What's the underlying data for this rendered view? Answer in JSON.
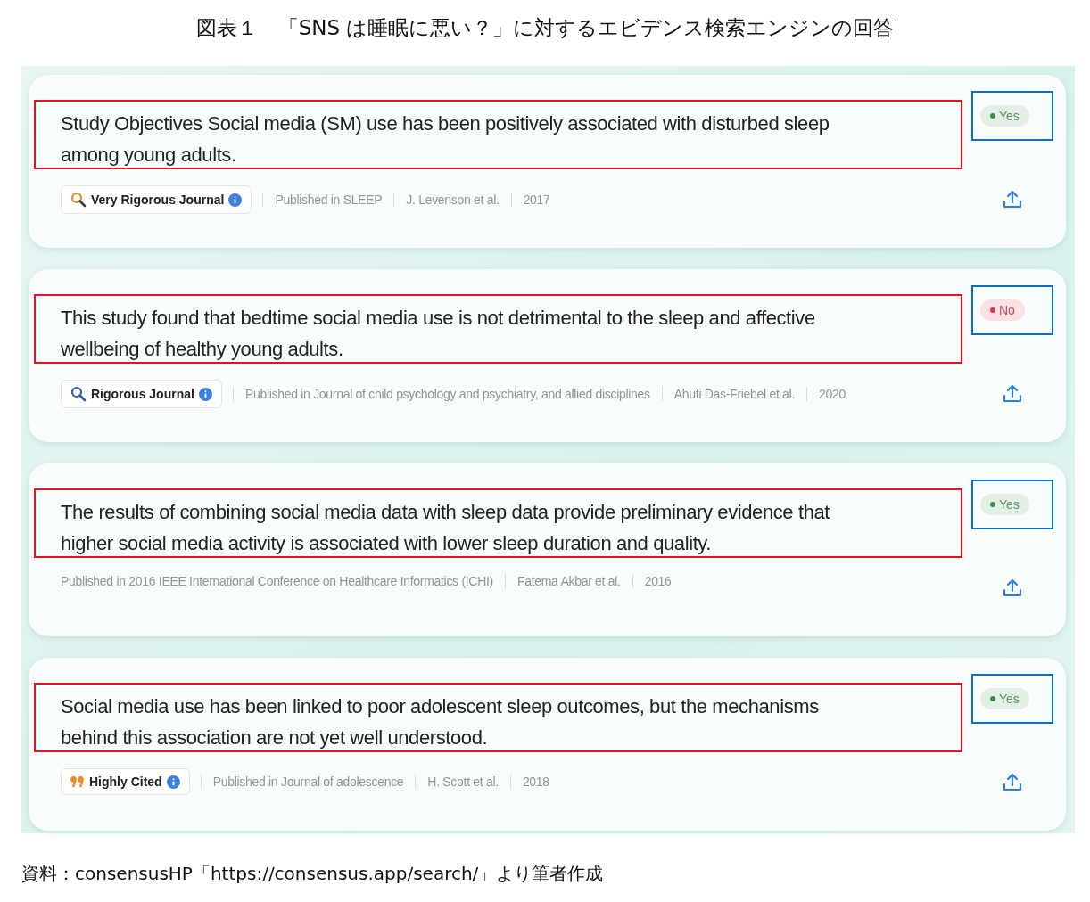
{
  "figure_title": "図表１　「SNS は睡眠に悪い？」に対するエビデンス検索エンジンの回答",
  "results": [
    {
      "claim": "Study Objectives Social media (SM) use has been positively associated with disturbed sleep among young adults.",
      "verdict": {
        "kind": "yes",
        "label": "Yes"
      },
      "badge": {
        "kind": "rigor",
        "label": "Very Rigorous Journal"
      },
      "meta": [
        "Published in SLEEP",
        "J. Levenson et al.",
        "2017"
      ]
    },
    {
      "claim": "This study found that bedtime social media use is not detrimental to the sleep and affective wellbeing of healthy young adults.",
      "verdict": {
        "kind": "no",
        "label": "No"
      },
      "badge": {
        "kind": "rigor-plain",
        "label": "Rigorous Journal"
      },
      "meta": [
        "Published in Journal of child psychology and psychiatry, and allied disciplines",
        "Ahuti Das-Friebel et al.",
        "2020"
      ]
    },
    {
      "claim": "The results of combining social media data with sleep data provide preliminary evidence that higher social media activity is associated with lower sleep duration and quality.",
      "verdict": {
        "kind": "yes",
        "label": "Yes"
      },
      "meta": [
        "Published in 2016 IEEE International Conference on Healthcare Informatics (ICHI)",
        "Fatema Akbar et al.",
        "2016"
      ]
    },
    {
      "claim": "Social media use has been linked to poor adolescent sleep outcomes, but the mechanisms behind this association are not yet well understood.",
      "verdict": {
        "kind": "yes",
        "label": "Yes"
      },
      "badge": {
        "kind": "cited",
        "label": "Highly Cited"
      },
      "meta": [
        "Published in Journal of adolescence",
        "H. Scott et al.",
        "2018"
      ]
    }
  ],
  "source_note": "資料：consensusHP「https://consensus.app/search/」より筆者作成"
}
